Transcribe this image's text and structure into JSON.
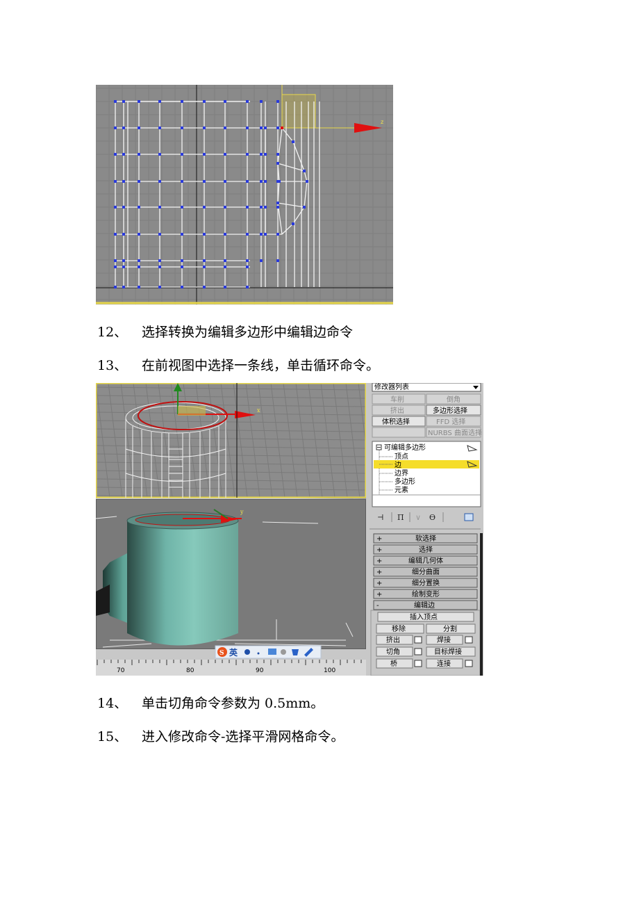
{
  "steps": [
    {
      "num": "12、",
      "text": "选择转换为编辑多边形中编辑边命令"
    },
    {
      "num": "13、",
      "text": "在前视图中选择一条线，单击循环命令。"
    },
    {
      "num": "14、",
      "text": "单击切角命令参数为 0.5mm。"
    },
    {
      "num": "15、",
      "text": "进入修改命令-选择平滑网格命令。"
    }
  ],
  "figure1": {
    "axis_label": "z"
  },
  "figure2": {
    "modifier_dropdown": "修改器列表",
    "buttons": {
      "lathe": "车削",
      "chamfer_top": "倒角",
      "extrude_top": "挤出",
      "poly_select": "多边形选择",
      "vol_select": "体积选择",
      "ffd_select": "FFD 选择",
      "nurbs_select": "NURBS 曲面选择"
    },
    "stack": {
      "root": "可编辑多边形",
      "items": [
        "顶点",
        "边",
        "边界",
        "多边形",
        "元素"
      ],
      "selected": "边"
    },
    "rollouts": [
      "软选择",
      "选择",
      "编辑几何体",
      "细分曲面",
      "细分置换",
      "绘制变形"
    ],
    "edit_edges": {
      "title": "编辑边",
      "insert_vertex": "插入顶点",
      "remove": "移除",
      "split": "分割",
      "extrude": "挤出",
      "weld": "焊接",
      "chamfer": "切角",
      "target_weld": "目标焊接",
      "bridge": "桥",
      "connect": "连接"
    },
    "ime_label": "英",
    "ruler_ticks": [
      "70",
      "80",
      "90",
      "100"
    ],
    "axis_x": "x",
    "axis_y": "y"
  }
}
